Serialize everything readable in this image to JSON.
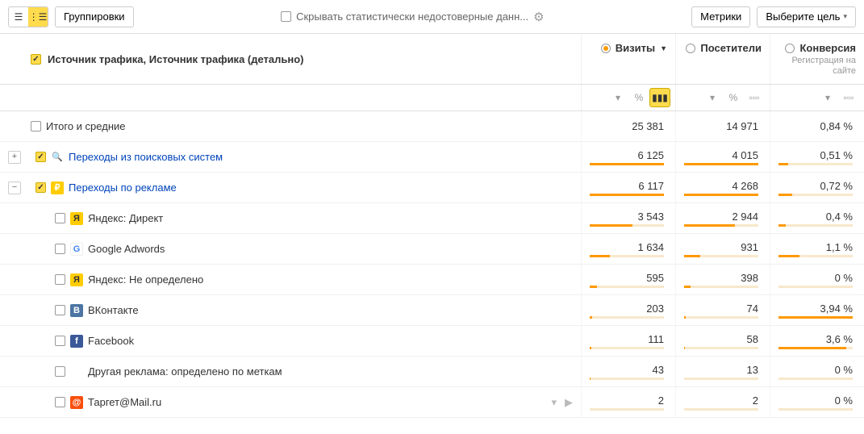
{
  "toolbar": {
    "groupings_btn": "Группировки",
    "hide_stat_label": "Скрывать статистически недостоверные данн...",
    "metrics_btn": "Метрики",
    "goal_btn": "Выберите цель"
  },
  "headers": {
    "dimension": "Источник трафика, Источник трафика (детально)",
    "visits": "Визиты",
    "visitors": "Посетители",
    "conversion": "Конверсия",
    "conversion_sub": "Регистрация на сайте"
  },
  "totals": {
    "label": "Итого и средние",
    "visits": "25 381",
    "visitors": "14 971",
    "conversion": "0,84 %"
  },
  "rows": [
    {
      "id": "search",
      "label": "Переходы из поисковых систем",
      "visits": "6 125",
      "visitors": "4 015",
      "conversion": "0,51 %",
      "bar_visits": 100,
      "bar_visitors": 100,
      "bar_conv": 13
    },
    {
      "id": "ads",
      "label": "Переходы по рекламе",
      "visits": "6 117",
      "visitors": "4 268",
      "conversion": "0,72 %",
      "bar_visits": 100,
      "bar_visitors": 100,
      "bar_conv": 18
    },
    {
      "id": "ydirect",
      "label": "Яндекс: Директ",
      "visits": "3 543",
      "visitors": "2 944",
      "conversion": "0,4 %",
      "bar_visits": 58,
      "bar_visitors": 69,
      "bar_conv": 10
    },
    {
      "id": "adwords",
      "label": "Google Adwords",
      "visits": "1 634",
      "visitors": "931",
      "conversion": "1,1 %",
      "bar_visits": 27,
      "bar_visitors": 22,
      "bar_conv": 28
    },
    {
      "id": "yundef",
      "label": "Яндекс: Не определено",
      "visits": "595",
      "visitors": "398",
      "conversion": "0 %",
      "bar_visits": 10,
      "bar_visitors": 9,
      "bar_conv": 0
    },
    {
      "id": "vk",
      "label": "ВКонтакте",
      "visits": "203",
      "visitors": "74",
      "conversion": "3,94 %",
      "bar_visits": 3,
      "bar_visitors": 2,
      "bar_conv": 100
    },
    {
      "id": "fb",
      "label": "Facebook",
      "visits": "111",
      "visitors": "58",
      "conversion": "3,6 %",
      "bar_visits": 2,
      "bar_visitors": 1,
      "bar_conv": 91
    },
    {
      "id": "other",
      "label": "Другая реклама: определено по меткам",
      "visits": "43",
      "visitors": "13",
      "conversion": "0 %",
      "bar_visits": 1,
      "bar_visitors": 0,
      "bar_conv": 0
    },
    {
      "id": "target",
      "label": "Таргет@Mail.ru",
      "visits": "2",
      "visitors": "2",
      "conversion": "0 %",
      "bar_visits": 0,
      "bar_visitors": 0,
      "bar_conv": 0
    }
  ],
  "chart_data": {
    "type": "table",
    "title": "Источник трафика, Источник трафика (детально)",
    "columns": [
      "Визиты",
      "Посетители",
      "Конверсия (Регистрация на сайте)"
    ],
    "totals": {
      "Визиты": 25381,
      "Посетители": 14971,
      "Конверсия": 0.84
    },
    "series": [
      {
        "name": "Переходы из поисковых систем",
        "values": [
          6125,
          4015,
          0.51
        ]
      },
      {
        "name": "Переходы по рекламе",
        "values": [
          6117,
          4268,
          0.72
        ]
      },
      {
        "name": "Яндекс: Директ",
        "values": [
          3543,
          2944,
          0.4
        ]
      },
      {
        "name": "Google Adwords",
        "values": [
          1634,
          931,
          1.1
        ]
      },
      {
        "name": "Яндекс: Не определено",
        "values": [
          595,
          398,
          0
        ]
      },
      {
        "name": "ВКонтакте",
        "values": [
          203,
          74,
          3.94
        ]
      },
      {
        "name": "Facebook",
        "values": [
          111,
          58,
          3.6
        ]
      },
      {
        "name": "Другая реклама: определено по меткам",
        "values": [
          43,
          13,
          0
        ]
      },
      {
        "name": "Таргет@Mail.ru",
        "values": [
          2,
          2,
          0
        ]
      }
    ]
  }
}
